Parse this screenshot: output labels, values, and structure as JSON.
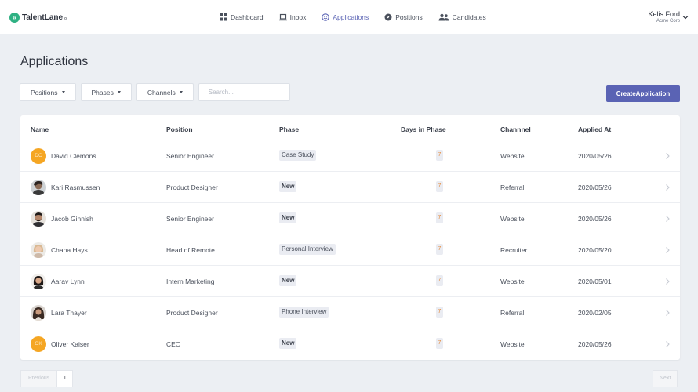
{
  "app": {
    "logo_text": "TalentLane",
    "logo_suffix": "io",
    "logo_icon": "double-chevron-icon"
  },
  "nav": {
    "items": [
      {
        "label": "Dashboard",
        "icon": "grid-icon",
        "active": false
      },
      {
        "label": "Inbox",
        "icon": "laptop-icon",
        "active": false
      },
      {
        "label": "Applications",
        "icon": "smiley-icon",
        "active": true
      },
      {
        "label": "Positions",
        "icon": "compass-icon",
        "active": false
      },
      {
        "label": "Candidates",
        "icon": "people-icon",
        "active": false
      }
    ]
  },
  "user": {
    "name": "Kelis Ford",
    "org": "Acme Corp"
  },
  "page": {
    "title": "Applications"
  },
  "filters": {
    "positions": "Positions",
    "phases": "Phases",
    "channels": "Channels",
    "search_placeholder": "Search..."
  },
  "actions": {
    "create": "CreateApplication"
  },
  "table": {
    "headers": {
      "name": "Name",
      "position": "Position",
      "phase": "Phase",
      "days": "Days in Phase",
      "channel": "Channnel",
      "applied": "Applied At"
    },
    "rows": [
      {
        "name": "David Clemons",
        "initials": "DC",
        "avatar": "initials",
        "position": "Senior Engineer",
        "phase": "Case Study",
        "phase_new": false,
        "days": "7",
        "channel": "Website",
        "applied": "2020/05/26"
      },
      {
        "name": "Kari Rasmussen",
        "initials": "",
        "avatar": "photo",
        "position": "Product Designer",
        "phase": "New",
        "phase_new": true,
        "days": "7",
        "channel": "Referral",
        "applied": "2020/05/26"
      },
      {
        "name": "Jacob Ginnish",
        "initials": "",
        "avatar": "photo",
        "position": "Senior Engineer",
        "phase": "New",
        "phase_new": true,
        "days": "7",
        "channel": "Website",
        "applied": "2020/05/26"
      },
      {
        "name": "Chana Hays",
        "initials": "",
        "avatar": "photo",
        "position": "Head of Remote",
        "phase": "Personal Interview",
        "phase_new": false,
        "days": "7",
        "channel": "Recruiter",
        "applied": "2020/05/20"
      },
      {
        "name": "Aarav Lynn",
        "initials": "",
        "avatar": "photo",
        "position": "Intern Marketing",
        "phase": "New",
        "phase_new": true,
        "days": "7",
        "channel": "Website",
        "applied": "2020/05/01"
      },
      {
        "name": "Lara Thayer",
        "initials": "",
        "avatar": "photo",
        "position": "Product Designer",
        "phase": "Phone Interview",
        "phase_new": false,
        "days": "7",
        "channel": "Referral",
        "applied": "2020/02/05"
      },
      {
        "name": "Oliver Kaiser",
        "initials": "OK",
        "avatar": "initials",
        "position": "CEO",
        "phase": "New",
        "phase_new": true,
        "days": "7",
        "channel": "Website",
        "applied": "2020/05/26"
      }
    ]
  },
  "pagination": {
    "previous": "Previous",
    "current": "1",
    "next": "Next"
  },
  "colors": {
    "accent": "#5a63b4",
    "logo": "#2fb183",
    "initials_avatar": "#f5a623",
    "days": "#e58a3a"
  }
}
